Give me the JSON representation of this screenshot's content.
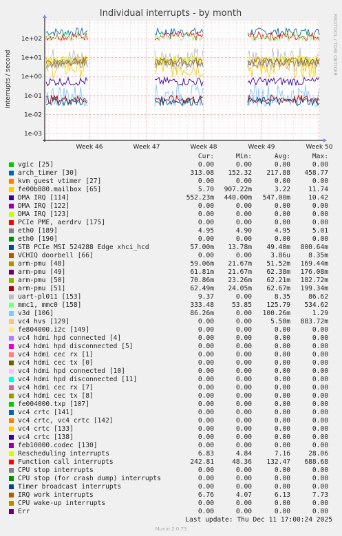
{
  "chart_data": {
    "type": "line",
    "title": "Individual interrupts - by month",
    "ylabel": "interrupts / second",
    "y_scale": "log",
    "y_ticks": [
      "1e+02",
      "1e+01",
      "1e+00",
      "1e-01",
      "1e-02",
      "1e-03"
    ],
    "x_ticks": [
      "Week 46",
      "Week 47",
      "Week 48",
      "Week 49",
      "Week 50"
    ],
    "side_label": "RRDTOOL / TOBI OETIKER",
    "grid": true
  },
  "legend": {
    "headers": {
      "cur": "Cur:",
      "min": "Min:",
      "avg": "Avg:",
      "max": "Max:"
    },
    "rows": [
      {
        "name": "vgic [25]",
        "color": "#00cc00",
        "cur": "0.00",
        "min": "0.00",
        "avg": "0.00",
        "max": "0.00"
      },
      {
        "name": "arch_timer [30]",
        "color": "#0066b3",
        "cur": "313.08",
        "min": "152.32",
        "avg": "217.88",
        "max": "458.77"
      },
      {
        "name": "kvm guest vtimer [27]",
        "color": "#ff8000",
        "cur": "0.00",
        "min": "0.00",
        "avg": "0.00",
        "max": "0.00"
      },
      {
        "name": "fe00b880.mailbox [65]",
        "color": "#ffcc00",
        "cur": "5.70",
        "min": "907.22m",
        "avg": "3.22",
        "max": "11.74"
      },
      {
        "name": "DMA IRQ [114]",
        "color": "#330099",
        "cur": "552.23m",
        "min": "440.00m",
        "avg": "547.00m",
        "max": "10.42"
      },
      {
        "name": "DMA IRQ [122]",
        "color": "#990099",
        "cur": "0.00",
        "min": "0.00",
        "avg": "0.00",
        "max": "0.00"
      },
      {
        "name": "DMA IRQ [123]",
        "color": "#ccff00",
        "cur": "0.00",
        "min": "0.00",
        "avg": "0.00",
        "max": "0.00"
      },
      {
        "name": "PCIe PME, aerdrv [175]",
        "color": "#ff0000",
        "cur": "0.00",
        "min": "0.00",
        "avg": "0.00",
        "max": "0.00"
      },
      {
        "name": "eth0 [189]",
        "color": "#808080",
        "cur": "4.95",
        "min": "4.90",
        "avg": "4.95",
        "max": "5.01"
      },
      {
        "name": "eth0 [190]",
        "color": "#008f00",
        "cur": "0.00",
        "min": "0.00",
        "avg": "0.00",
        "max": "0.00"
      },
      {
        "name": "STB PCIe MSI 524288 Edge      xhci_hcd",
        "color": "#00487d",
        "cur": "57.00m",
        "min": "13.78m",
        "avg": "49.40m",
        "max": "800.64m"
      },
      {
        "name": "VCHIQ doorbell [66]",
        "color": "#b35a00",
        "cur": "0.00",
        "min": "0.00",
        "avg": "3.86u",
        "max": "8.35m"
      },
      {
        "name": "arm-pmu [48]",
        "color": "#b38f00",
        "cur": "59.06m",
        "min": "21.67m",
        "avg": "51.52m",
        "max": "169.44m"
      },
      {
        "name": "arm-pmu [49]",
        "color": "#6b006b",
        "cur": "61.81m",
        "min": "21.67m",
        "avg": "62.38m",
        "max": "176.08m"
      },
      {
        "name": "arm-pmu [50]",
        "color": "#8fb300",
        "cur": "70.86m",
        "min": "23.26m",
        "avg": "62.21m",
        "max": "182.72m"
      },
      {
        "name": "arm-pmu [51]",
        "color": "#b30000",
        "cur": "62.49m",
        "min": "24.05m",
        "avg": "62.67m",
        "max": "199.34m"
      },
      {
        "name": "uart-pl011 [153]",
        "color": "#bebebe",
        "cur": "9.37",
        "min": "0.00",
        "avg": "8.35",
        "max": "86.62"
      },
      {
        "name": "mmc1, mmc0 [158]",
        "color": "#80ff80",
        "cur": "333.48",
        "min": "53.85",
        "avg": "125.79",
        "max": "534.62"
      },
      {
        "name": "v3d [106]",
        "color": "#80c9ff",
        "cur": "86.26m",
        "min": "0.00",
        "avg": "100.26m",
        "max": "1.29"
      },
      {
        "name": "vc4 hvs [129]",
        "color": "#ffc080",
        "cur": "0.00",
        "min": "0.00",
        "avg": "5.50m",
        "max": "883.72m"
      },
      {
        "name": "fe804000.i2c [149]",
        "color": "#ffe680",
        "cur": "0.00",
        "min": "0.00",
        "avg": "0.00",
        "max": "0.00"
      },
      {
        "name": "vc4 hdmi hpd connected [4]",
        "color": "#aa80ff",
        "cur": "0.00",
        "min": "0.00",
        "avg": "0.00",
        "max": "0.00"
      },
      {
        "name": "vc4 hdmi hpd disconnected [5]",
        "color": "#ee00cc",
        "cur": "0.00",
        "min": "0.00",
        "avg": "0.00",
        "max": "0.00"
      },
      {
        "name": "vc4 hdmi cec rx [1]",
        "color": "#ff8080",
        "cur": "0.00",
        "min": "0.00",
        "avg": "0.00",
        "max": "0.00"
      },
      {
        "name": "vc4 hdmi cec tx [0]",
        "color": "#666600",
        "cur": "0.00",
        "min": "0.00",
        "avg": "0.00",
        "max": "0.00"
      },
      {
        "name": "vc4 hdmi hpd connected [10]",
        "color": "#ffbfff",
        "cur": "0.00",
        "min": "0.00",
        "avg": "0.00",
        "max": "0.00"
      },
      {
        "name": "vc4 hdmi hpd disconnected [11]",
        "color": "#00ffcc",
        "cur": "0.00",
        "min": "0.00",
        "avg": "0.00",
        "max": "0.00"
      },
      {
        "name": "vc4 hdmi cec rx [7]",
        "color": "#cc6699",
        "cur": "0.00",
        "min": "0.00",
        "avg": "0.00",
        "max": "0.00"
      },
      {
        "name": "vc4 hdmi cec tx [8]",
        "color": "#999900",
        "cur": "0.00",
        "min": "0.00",
        "avg": "0.00",
        "max": "0.00"
      },
      {
        "name": "fe004000.txp [107]",
        "color": "#00cc00",
        "cur": "0.00",
        "min": "0.00",
        "avg": "0.00",
        "max": "0.00"
      },
      {
        "name": "vc4 crtc [141]",
        "color": "#0066b3",
        "cur": "0.00",
        "min": "0.00",
        "avg": "0.00",
        "max": "0.00"
      },
      {
        "name": "vc4 crtc, vc4 crtc [142]",
        "color": "#ff8000",
        "cur": "0.00",
        "min": "0.00",
        "avg": "0.00",
        "max": "0.00"
      },
      {
        "name": "vc4 crtc [133]",
        "color": "#ffcc00",
        "cur": "0.00",
        "min": "0.00",
        "avg": "0.00",
        "max": "0.00"
      },
      {
        "name": "vc4 crtc [138]",
        "color": "#330099",
        "cur": "0.00",
        "min": "0.00",
        "avg": "0.00",
        "max": "0.00"
      },
      {
        "name": "feb10000.codec [130]",
        "color": "#990099",
        "cur": "0.00",
        "min": "0.00",
        "avg": "0.00",
        "max": "0.00"
      },
      {
        "name": "Rescheduling interrupts",
        "color": "#ccff00",
        "cur": "6.83",
        "min": "4.84",
        "avg": "7.16",
        "max": "28.06"
      },
      {
        "name": "Function call interrupts",
        "color": "#ff0000",
        "cur": "242.81",
        "min": "48.36",
        "avg": "132.47",
        "max": "688.68"
      },
      {
        "name": "CPU stop interrupts",
        "color": "#808080",
        "cur": "0.00",
        "min": "0.00",
        "avg": "0.00",
        "max": "0.00"
      },
      {
        "name": "CPU stop (for crash dump) interrupts",
        "color": "#008f00",
        "cur": "0.00",
        "min": "0.00",
        "avg": "0.00",
        "max": "0.00"
      },
      {
        "name": "Timer broadcast interrupts",
        "color": "#00487d",
        "cur": "0.00",
        "min": "0.00",
        "avg": "0.00",
        "max": "0.00"
      },
      {
        "name": "IRQ work interrupts",
        "color": "#b35a00",
        "cur": "6.76",
        "min": "4.07",
        "avg": "6.13",
        "max": "7.73"
      },
      {
        "name": "CPU wake-up interrupts",
        "color": "#b38f00",
        "cur": "0.00",
        "min": "0.00",
        "avg": "0.00",
        "max": "0.00"
      },
      {
        "name": "Err",
        "color": "#6b006b",
        "cur": "0.00",
        "min": "0.00",
        "avg": "0.00",
        "max": "0.00"
      }
    ]
  },
  "footer": {
    "last_update": "Last update: Thu Dec 11 17:00:24 2025",
    "generator": "Munin 2.0.73"
  }
}
